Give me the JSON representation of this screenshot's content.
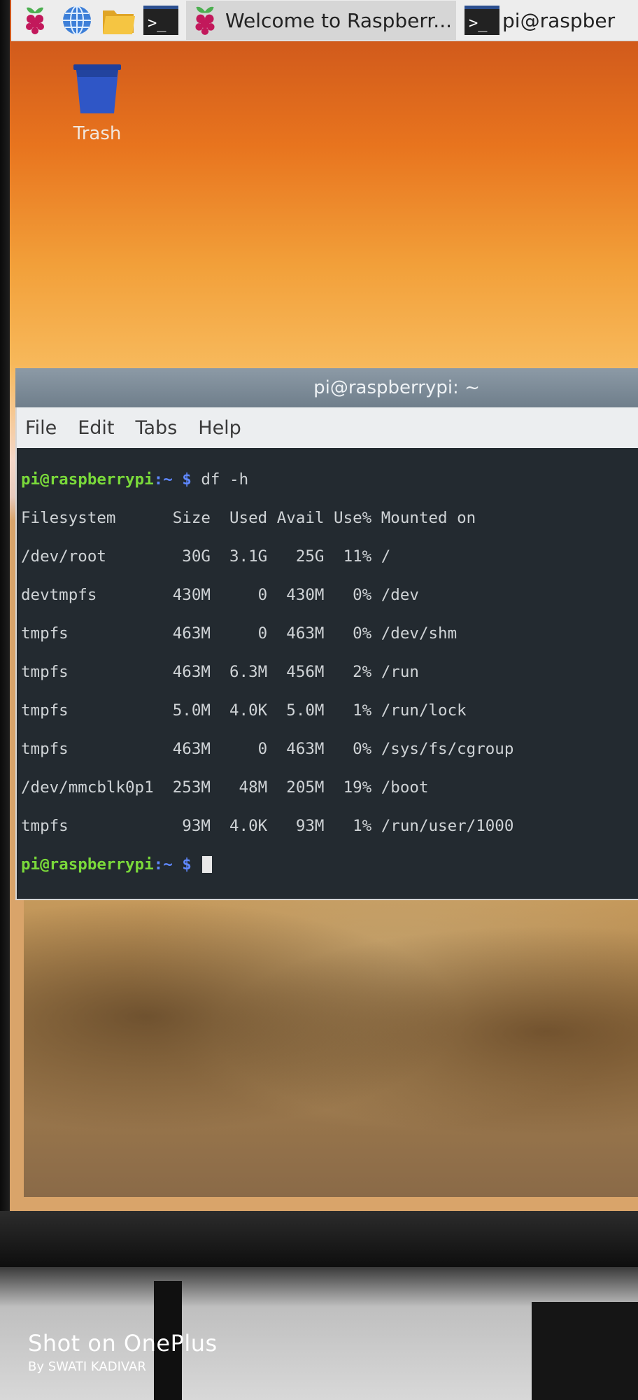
{
  "taskbar": {
    "icons": [
      "raspberry-menu-icon",
      "web-browser-icon",
      "file-manager-icon",
      "terminal-icon"
    ],
    "tasks": [
      {
        "label": "Welcome to Raspberr...",
        "icon": "raspberry-icon",
        "active": true
      },
      {
        "label": "pi@raspber",
        "icon": "terminal-icon",
        "active": false
      }
    ],
    "terminal_glyph": ">_"
  },
  "desktop": {
    "trash_label": "Trash"
  },
  "terminal": {
    "title": "pi@raspberrypi: ~",
    "menu": [
      "File",
      "Edit",
      "Tabs",
      "Help"
    ],
    "prompt_user": "pi@raspberrypi",
    "prompt_path": ":~",
    "prompt_symbol": " $ ",
    "command": "df -h",
    "output": [
      "Filesystem      Size  Used Avail Use% Mounted on",
      "/dev/root        30G  3.1G   25G  11% /",
      "devtmpfs        430M     0  430M   0% /dev",
      "tmpfs           463M     0  463M   0% /dev/shm",
      "tmpfs           463M  6.3M  456M   2% /run",
      "tmpfs           5.0M  4.0K  5.0M   1% /run/lock",
      "tmpfs           463M     0  463M   0% /sys/fs/cgroup",
      "/dev/mmcblk0p1  253M   48M  205M  19% /boot",
      "tmpfs            93M  4.0K   93M   1% /run/user/1000"
    ]
  },
  "watermark": {
    "title": "Shot on OnePlus",
    "subtitle": "By SWATI KADIVAR"
  }
}
